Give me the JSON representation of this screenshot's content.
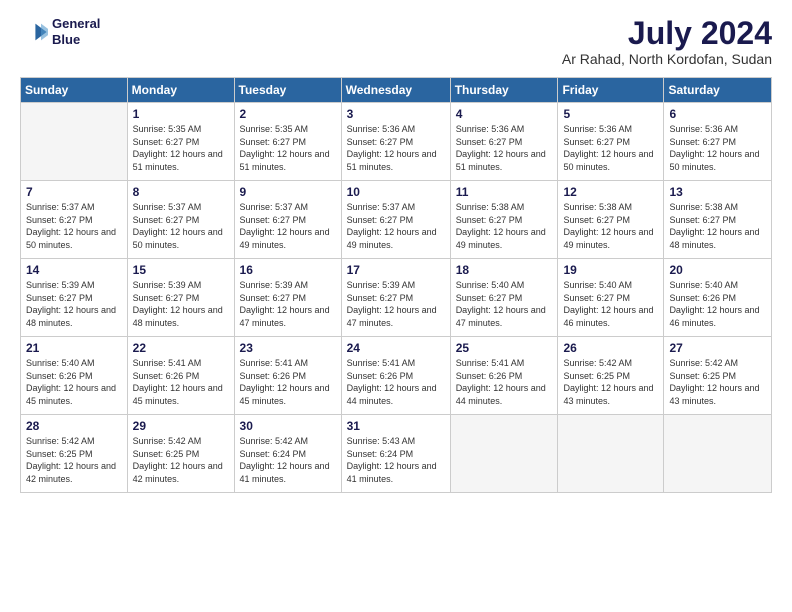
{
  "logo": {
    "line1": "General",
    "line2": "Blue"
  },
  "title": "July 2024",
  "subtitle": "Ar Rahad, North Kordofan, Sudan",
  "days_of_week": [
    "Sunday",
    "Monday",
    "Tuesday",
    "Wednesday",
    "Thursday",
    "Friday",
    "Saturday"
  ],
  "weeks": [
    [
      {
        "day": "",
        "empty": true
      },
      {
        "day": "1",
        "sunrise": "5:35 AM",
        "sunset": "6:27 PM",
        "daylight": "12 hours and 51 minutes."
      },
      {
        "day": "2",
        "sunrise": "5:35 AM",
        "sunset": "6:27 PM",
        "daylight": "12 hours and 51 minutes."
      },
      {
        "day": "3",
        "sunrise": "5:36 AM",
        "sunset": "6:27 PM",
        "daylight": "12 hours and 51 minutes."
      },
      {
        "day": "4",
        "sunrise": "5:36 AM",
        "sunset": "6:27 PM",
        "daylight": "12 hours and 51 minutes."
      },
      {
        "day": "5",
        "sunrise": "5:36 AM",
        "sunset": "6:27 PM",
        "daylight": "12 hours and 50 minutes."
      },
      {
        "day": "6",
        "sunrise": "5:36 AM",
        "sunset": "6:27 PM",
        "daylight": "12 hours and 50 minutes."
      }
    ],
    [
      {
        "day": "7",
        "sunrise": "5:37 AM",
        "sunset": "6:27 PM",
        "daylight": "12 hours and 50 minutes."
      },
      {
        "day": "8",
        "sunrise": "5:37 AM",
        "sunset": "6:27 PM",
        "daylight": "12 hours and 50 minutes."
      },
      {
        "day": "9",
        "sunrise": "5:37 AM",
        "sunset": "6:27 PM",
        "daylight": "12 hours and 49 minutes."
      },
      {
        "day": "10",
        "sunrise": "5:37 AM",
        "sunset": "6:27 PM",
        "daylight": "12 hours and 49 minutes."
      },
      {
        "day": "11",
        "sunrise": "5:38 AM",
        "sunset": "6:27 PM",
        "daylight": "12 hours and 49 minutes."
      },
      {
        "day": "12",
        "sunrise": "5:38 AM",
        "sunset": "6:27 PM",
        "daylight": "12 hours and 49 minutes."
      },
      {
        "day": "13",
        "sunrise": "5:38 AM",
        "sunset": "6:27 PM",
        "daylight": "12 hours and 48 minutes."
      }
    ],
    [
      {
        "day": "14",
        "sunrise": "5:39 AM",
        "sunset": "6:27 PM",
        "daylight": "12 hours and 48 minutes."
      },
      {
        "day": "15",
        "sunrise": "5:39 AM",
        "sunset": "6:27 PM",
        "daylight": "12 hours and 48 minutes."
      },
      {
        "day": "16",
        "sunrise": "5:39 AM",
        "sunset": "6:27 PM",
        "daylight": "12 hours and 47 minutes."
      },
      {
        "day": "17",
        "sunrise": "5:39 AM",
        "sunset": "6:27 PM",
        "daylight": "12 hours and 47 minutes."
      },
      {
        "day": "18",
        "sunrise": "5:40 AM",
        "sunset": "6:27 PM",
        "daylight": "12 hours and 47 minutes."
      },
      {
        "day": "19",
        "sunrise": "5:40 AM",
        "sunset": "6:27 PM",
        "daylight": "12 hours and 46 minutes."
      },
      {
        "day": "20",
        "sunrise": "5:40 AM",
        "sunset": "6:26 PM",
        "daylight": "12 hours and 46 minutes."
      }
    ],
    [
      {
        "day": "21",
        "sunrise": "5:40 AM",
        "sunset": "6:26 PM",
        "daylight": "12 hours and 45 minutes."
      },
      {
        "day": "22",
        "sunrise": "5:41 AM",
        "sunset": "6:26 PM",
        "daylight": "12 hours and 45 minutes."
      },
      {
        "day": "23",
        "sunrise": "5:41 AM",
        "sunset": "6:26 PM",
        "daylight": "12 hours and 45 minutes."
      },
      {
        "day": "24",
        "sunrise": "5:41 AM",
        "sunset": "6:26 PM",
        "daylight": "12 hours and 44 minutes."
      },
      {
        "day": "25",
        "sunrise": "5:41 AM",
        "sunset": "6:26 PM",
        "daylight": "12 hours and 44 minutes."
      },
      {
        "day": "26",
        "sunrise": "5:42 AM",
        "sunset": "6:25 PM",
        "daylight": "12 hours and 43 minutes."
      },
      {
        "day": "27",
        "sunrise": "5:42 AM",
        "sunset": "6:25 PM",
        "daylight": "12 hours and 43 minutes."
      }
    ],
    [
      {
        "day": "28",
        "sunrise": "5:42 AM",
        "sunset": "6:25 PM",
        "daylight": "12 hours and 42 minutes."
      },
      {
        "day": "29",
        "sunrise": "5:42 AM",
        "sunset": "6:25 PM",
        "daylight": "12 hours and 42 minutes."
      },
      {
        "day": "30",
        "sunrise": "5:42 AM",
        "sunset": "6:24 PM",
        "daylight": "12 hours and 41 minutes."
      },
      {
        "day": "31",
        "sunrise": "5:43 AM",
        "sunset": "6:24 PM",
        "daylight": "12 hours and 41 minutes."
      },
      {
        "day": "",
        "empty": true
      },
      {
        "day": "",
        "empty": true
      },
      {
        "day": "",
        "empty": true
      }
    ]
  ],
  "labels": {
    "sunrise": "Sunrise:",
    "sunset": "Sunset:",
    "daylight": "Daylight:"
  },
  "colors": {
    "header_bg": "#2a65a0",
    "header_text": "#ffffff",
    "title_color": "#1a1a4e"
  }
}
